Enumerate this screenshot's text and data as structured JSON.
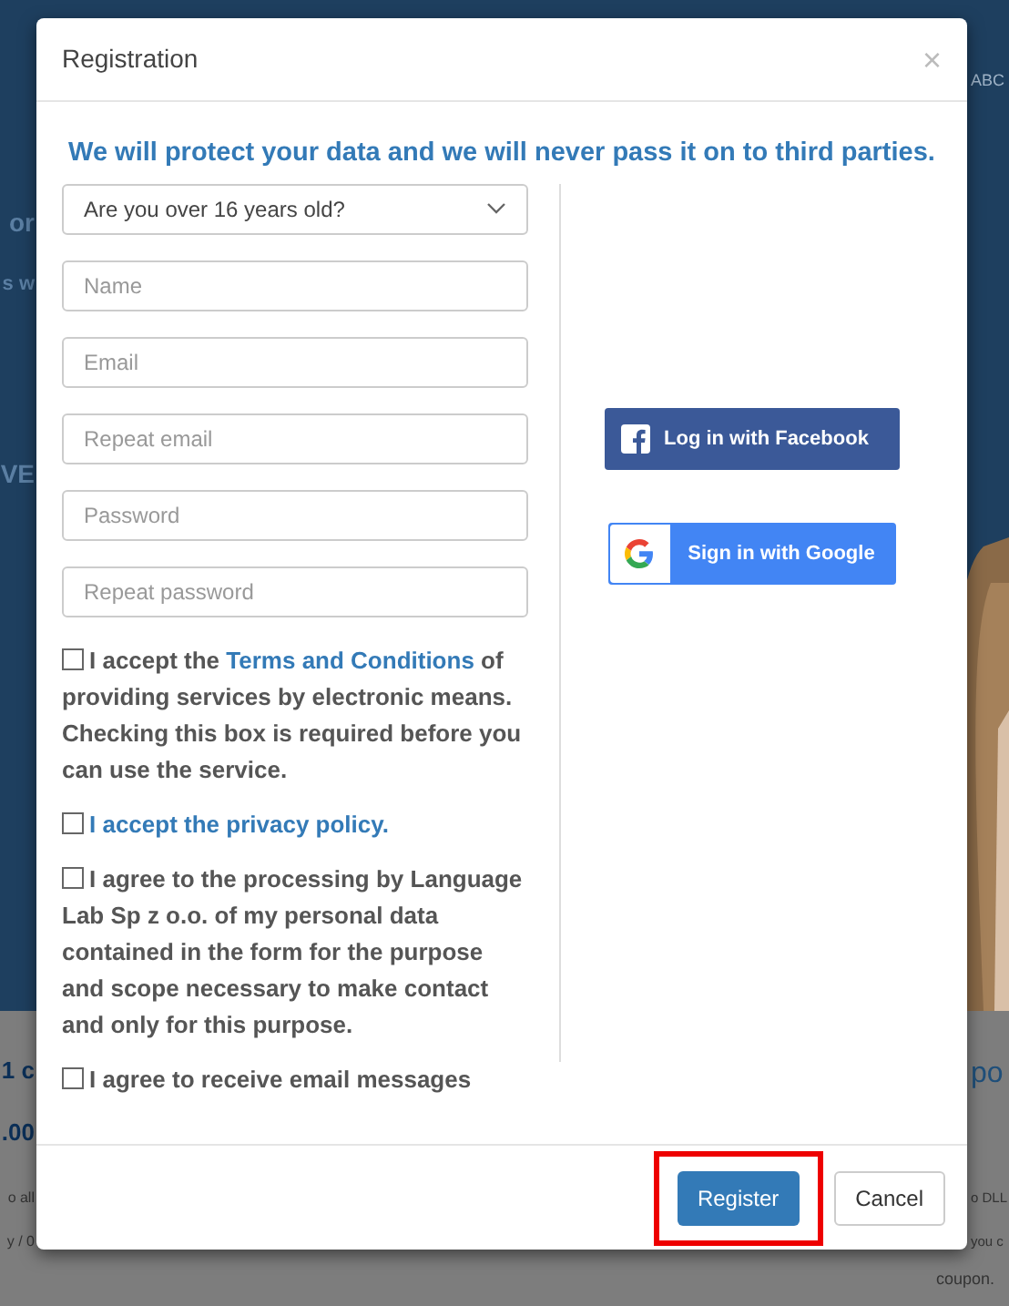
{
  "backdrop": {
    "texts_left": [
      "or",
      "s w",
      "VE",
      "1 c",
      ".00",
      "o all",
      "y / 0"
    ],
    "texts_right": [
      "ABC",
      "po",
      "o DLL",
      "you c",
      "coupon."
    ]
  },
  "dialog": {
    "title": "Registration",
    "close": "×",
    "notice": "We will protect your data and we will never pass it on to third parties.",
    "age_select": {
      "value": "Are you over 16 years old?"
    },
    "fields": [
      {
        "placeholder": "Name"
      },
      {
        "placeholder": "Email"
      },
      {
        "placeholder": "Repeat email"
      },
      {
        "placeholder": "Password"
      },
      {
        "placeholder": "Repeat password"
      }
    ],
    "consents": [
      {
        "kind": "terms",
        "text_before": "I accept the",
        "link": "Terms and Conditions",
        "text_after": "of providing services by electronic means. Checking this box is required before you can use the service.",
        "checked": false
      },
      {
        "kind": "link",
        "link": "I accept the privacy policy.",
        "checked": false
      },
      {
        "kind": "plain",
        "text": "I agree to the processing by Language Lab Sp z o.o. of my personal data contained in the form for the purpose and scope necessary to make contact and only for this purpose.",
        "checked": false
      },
      {
        "kind": "plain",
        "text": "I agree to receive email messages",
        "checked": false
      }
    ],
    "social": [
      {
        "kind": "facebook",
        "label": "Log in with Facebook"
      },
      {
        "kind": "google",
        "label": "Sign in with Google"
      }
    ],
    "buttons": [
      {
        "kind": "primary",
        "label": "Register",
        "highlighted": true
      },
      {
        "kind": "default",
        "label": "Cancel",
        "highlighted": false
      }
    ]
  }
}
